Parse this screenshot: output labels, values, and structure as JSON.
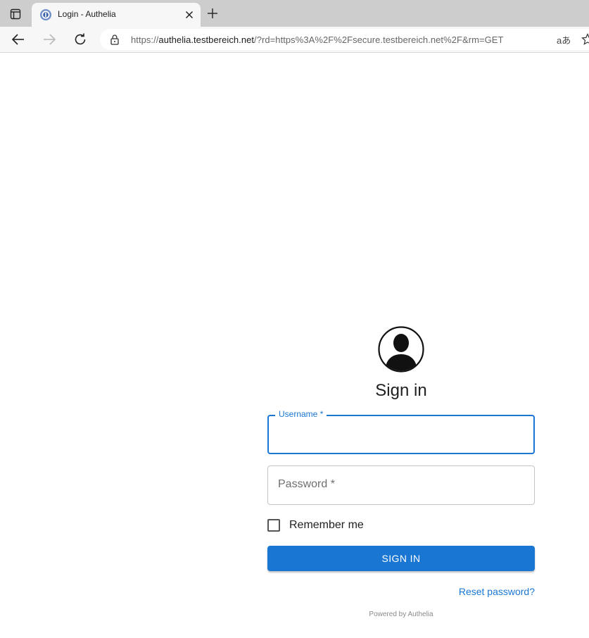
{
  "browser": {
    "tab_title": "Login - Authelia",
    "url_scheme": "https://",
    "url_host": "authelia.testbereich.net",
    "url_rest": "/?rd=https%3A%2F%2Fsecure.testbereich.net%2F&rm=GET",
    "read_aloud_glyph": "aあ",
    "icons": {
      "tab_actions": "tab-actions-icon",
      "favicon": "authelia-favicon",
      "tab_close": "close-icon",
      "new_tab": "plus-icon",
      "back": "back-arrow-icon",
      "forward": "forward-arrow-icon",
      "reload": "reload-icon",
      "lock": "lock-icon",
      "favorite": "star-icon"
    }
  },
  "login": {
    "title": "Sign in",
    "username_label": "Username *",
    "username_value": "",
    "password_label": "Password *",
    "password_value": "",
    "remember_label": "Remember me",
    "remember_checked": false,
    "signin_button": "SIGN IN",
    "reset_link": "Reset password?",
    "powered_by": "Powered by Authelia",
    "icons": {
      "avatar": "user-avatar-icon"
    }
  },
  "colors": {
    "primary": "#1976d2",
    "tabstrip": "#cdcdcd",
    "toolbar": "#f7f7f7"
  }
}
